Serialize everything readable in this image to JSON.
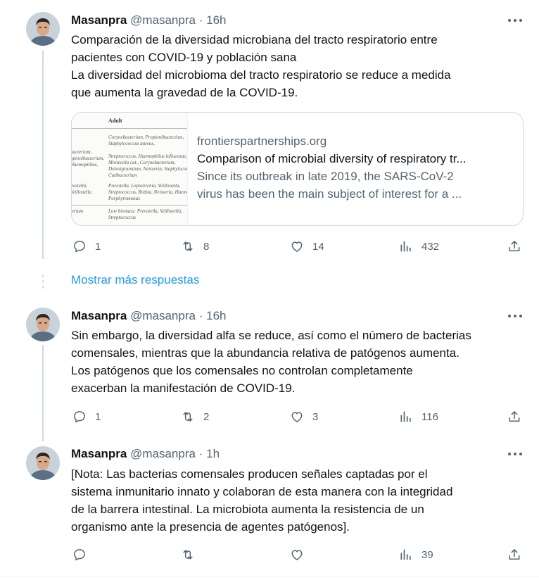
{
  "tweets": [
    {
      "author": "Masanpra",
      "handle": "@masanpra",
      "separator": "·",
      "time": "16h",
      "lines": [
        "Comparación de la diversidad microbiana del tracto respiratorio entre",
        "pacientes con COVID-19 y población sana",
        "La diversidad del microbioma del tracto respiratorio se reduce a medida",
        "que aumenta la gravedad de la COVID-19."
      ],
      "card": {
        "domain": "frontierspartnerships.org",
        "title": "Comparison of microbial diversity of respiratory tr...",
        "description_lines": [
          "Since its outbreak in late 2019, the SARS-CoV-2",
          "virus has been the main subject of interest for a ..."
        ],
        "thumbnail": {
          "header": "Adult",
          "cells": [
            "Corynebacterium, Propionibacterium,",
            "Staphylococcus aureus,",
            "Streptococcus, Haemophilus influenzae,",
            "Moraxella cat., Corynebacterium,",
            "Dolosigranulum, Neisseria, Staphylococcus,",
            "Cutibacterium",
            "Prevotella, Leptotrichia, Veillonella,",
            "Streptococcus, Rothia, Neisseria, Haemophilus,",
            "Porphyromonas",
            "Low biomass: Prevotella, Veillonella,",
            "Streptococcus"
          ],
          "left_cells": [
            "bacterium,",
            "opionibacterium,",
            "Haemophilus,",
            "evotella,",
            "Veillonella",
            "terium"
          ]
        }
      },
      "stats": {
        "replies": "1",
        "retweets": "8",
        "likes": "14",
        "views": "432"
      }
    },
    {
      "author": "Masanpra",
      "handle": "@masanpra",
      "separator": "·",
      "time": "16h",
      "lines": [
        "Sin embargo, la diversidad alfa se reduce, así como el número de bacterias",
        "comensales, mientras que la abundancia relativa de patógenos aumenta.",
        "Los patógenos que los comensales no controlan completamente",
        "exacerban la manifestación de COVID-19."
      ],
      "stats": {
        "replies": "1",
        "retweets": "2",
        "likes": "3",
        "views": "116"
      }
    },
    {
      "author": "Masanpra",
      "handle": "@masanpra",
      "separator": "·",
      "time": "1h",
      "lines": [
        "[Nota: Las bacterias comensales producen señales captadas por el",
        "sistema inmunitario innato y colaboran de esta manera con la integridad",
        "de la barrera intestinal. La microbiota aumenta la resistencia de un",
        "organismo ante la presencia de agentes patógenos]."
      ],
      "stats": {
        "replies": "",
        "retweets": "",
        "likes": "",
        "views": "39"
      }
    }
  ],
  "show_more_label": "Mostrar más respuestas",
  "icons": {
    "reply": "reply-icon",
    "retweet": "retweet-icon",
    "like": "like-icon",
    "views": "views-icon",
    "share": "share-icon",
    "more": "more-icon"
  },
  "colors": {
    "text": "#0f1419",
    "secondary": "#536471",
    "link": "#1d9bf0",
    "border": "#cfd9de"
  }
}
